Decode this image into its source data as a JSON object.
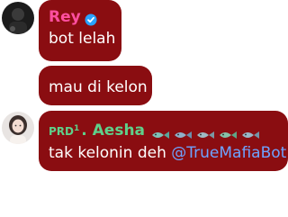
{
  "messages": [
    {
      "sender": "Rey",
      "verified": true,
      "text": "bot lelah"
    },
    {
      "text": "mau di kelon"
    },
    {
      "sender_tag": "PRD",
      "sender_tag_sup": "1",
      "sender_name": ". Aesha",
      "badge_icons": [
        "fish-icon",
        "fish-icon",
        "fish-icon",
        "fish-icon",
        "fish-icon"
      ],
      "text_before_mention": "tak kelonin deh ",
      "mention": "@TrueMafiaBot"
    }
  ],
  "colors": {
    "bubble": "#8a0d11",
    "sender_rey": "#ff4fa0",
    "sender_aesha": "#5fd08a",
    "mention": "#6ea3ff",
    "verified": "#2aa3ff"
  }
}
